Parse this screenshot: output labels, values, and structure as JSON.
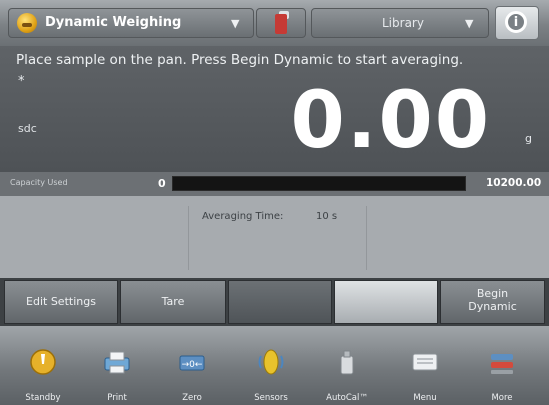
{
  "topbar": {
    "app_label": "Dynamic Weighing",
    "library_label": "Library",
    "info_glyph": "i"
  },
  "reading": {
    "prompt": "Place sample on the pan. Press Begin Dynamic to start averaging.",
    "star": "*",
    "stability": "sdc",
    "value": "0.00",
    "unit": "g"
  },
  "capacity": {
    "label": "Capacity Used",
    "min": "0",
    "max": "10200.00"
  },
  "panel": {
    "averaging_label": "Averaging Time:",
    "averaging_value": "10 s"
  },
  "actions": {
    "edit_settings": "Edit Settings",
    "tare": "Tare",
    "begin_line1": "Begin",
    "begin_line2": "Dynamic"
  },
  "nav": [
    {
      "label": "Standby",
      "icon": "standby-icon"
    },
    {
      "label": "Print",
      "icon": "print-icon"
    },
    {
      "label": "Zero",
      "icon": "zero-icon"
    },
    {
      "label": "Sensors",
      "icon": "sensors-icon"
    },
    {
      "label": "AutoCal™",
      "icon": "autocal-icon"
    },
    {
      "label": "Menu",
      "icon": "menu-icon"
    },
    {
      "label": "More",
      "icon": "more-icon"
    }
  ],
  "colors": {
    "accent": "#e0a216",
    "background": "#62666a",
    "panel": "#a7abaf"
  }
}
